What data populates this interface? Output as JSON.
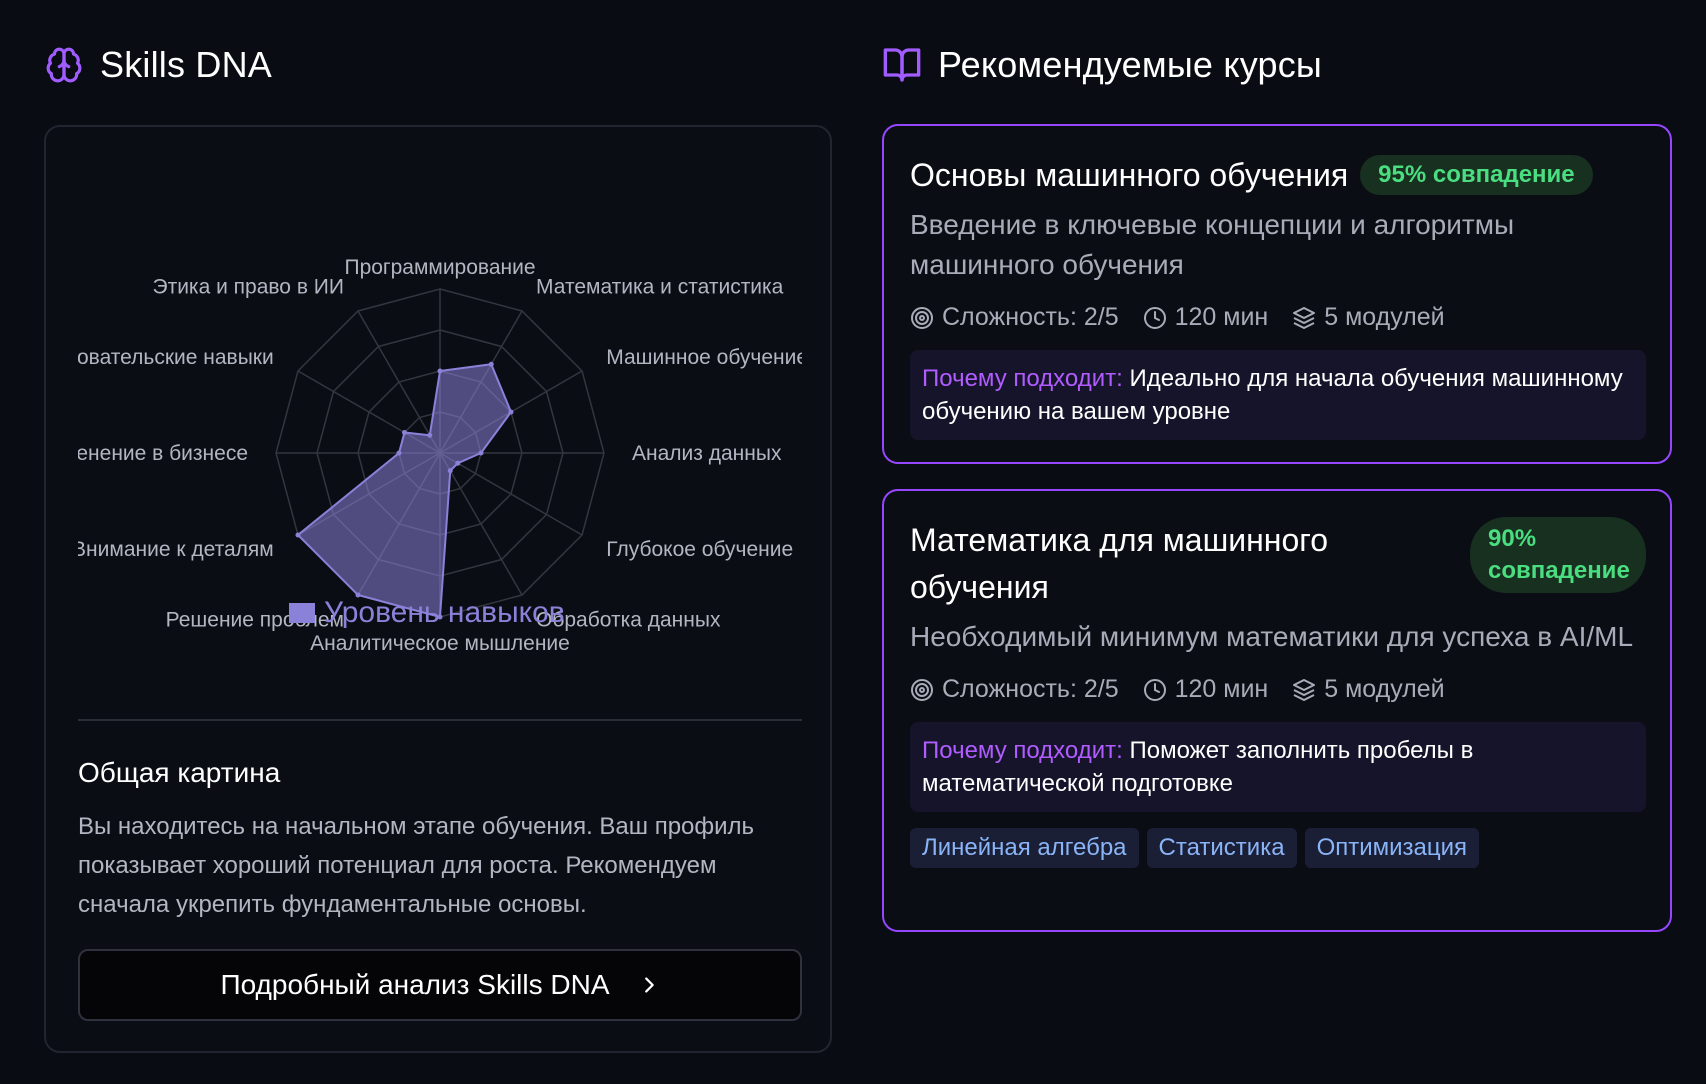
{
  "skills": {
    "title": "Skills DNA",
    "icon": "brain-icon"
  },
  "chart_data": {
    "type": "radar",
    "axes": [
      "Программирование",
      "Математика и статистика",
      "Машинное обучение",
      "Анализ данных",
      "Глубокое обучение",
      "Обработка данных",
      "Аналитическое мышление",
      "Решение проблем",
      "Внимание к деталям",
      "Применение в бизнесе",
      "Исследовательские навыки",
      "Этика и право в ИИ"
    ],
    "series": [
      {
        "name": "Уровень навыков",
        "values": [
          40,
          50,
          40,
          20,
          10,
          10,
          80,
          80,
          80,
          20,
          20,
          10
        ]
      }
    ],
    "rmax": 80,
    "rings": 4,
    "color": "#8a82d8",
    "legend": "bottom"
  },
  "overview": {
    "title": "Общая картина",
    "text": "Вы находитесь на начальном этапе обучения. Ваш профиль показывает хороший потенциал для роста. Рекомендуем сначала укрепить фундаментальные основы."
  },
  "detail_button": {
    "label": "Подробный анализ Skills DNA"
  },
  "courses": {
    "title": "Рекомендуемые курсы",
    "icon": "book-icon",
    "items": [
      {
        "title": "Основы машинного обучения",
        "match": "95% совпадение",
        "description": "Введение в ключевые концепции и алгоритмы машинного обучения",
        "difficulty": "Сложность: 2/5",
        "duration": "120 мин",
        "modules": "5 модулей",
        "why_label": "Почему подходит:",
        "why_text": "Идеально для начала обучения машинному обучению на вашем уровне"
      },
      {
        "title": "Математика для машинного обучения",
        "match": "90% совпадение",
        "description": "Необходимый минимум математики для успеха в AI/ML",
        "difficulty": "Сложность: 2/5",
        "duration": "120 мин",
        "modules": "5 модулей",
        "why_label": "Почему подходит:",
        "why_text": "Поможет заполнить пробелы в математической подготовке",
        "tags": [
          "Линейная алгебра",
          "Статистика",
          "Оптимизация"
        ]
      }
    ]
  },
  "colors": {
    "accent": "#9646ff",
    "match_text": "#4ade80",
    "tag_text": "#8ab4f8"
  }
}
